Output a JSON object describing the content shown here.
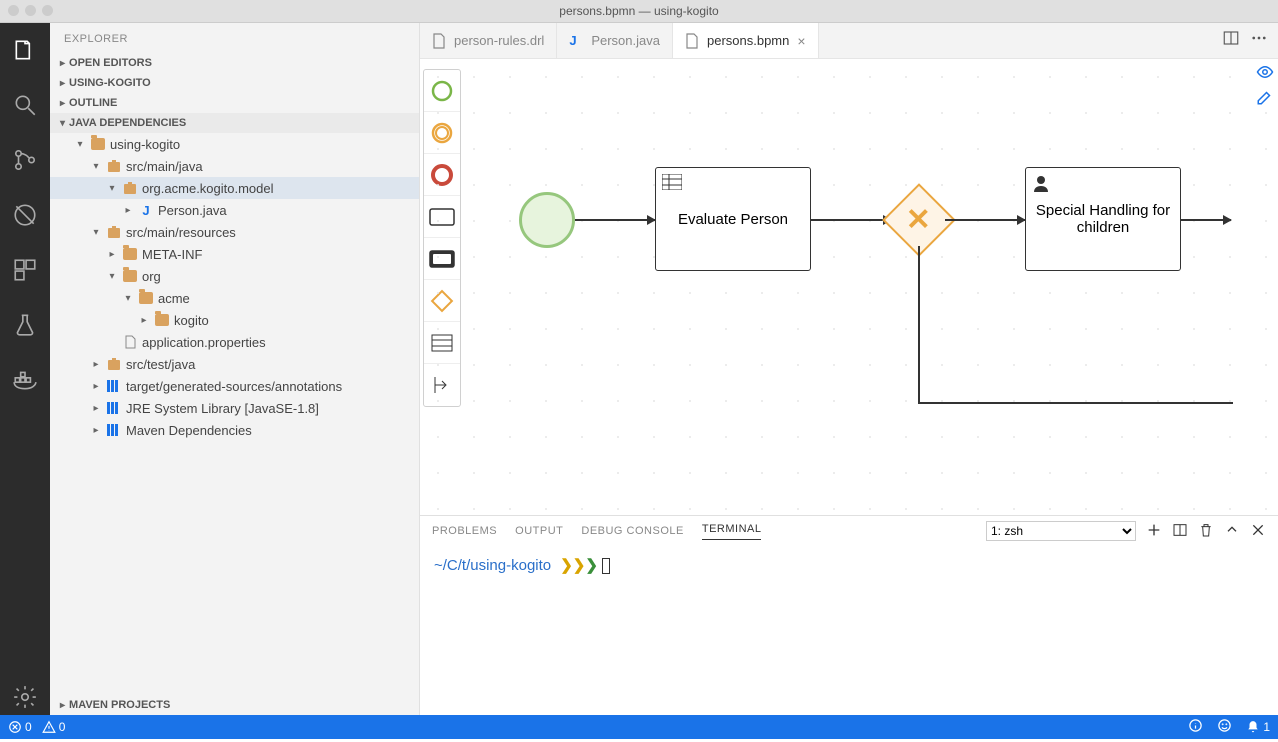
{
  "window": {
    "title": "persons.bpmn — using-kogito"
  },
  "sidebar": {
    "title": "EXPLORER",
    "sections": [
      {
        "label": "OPEN EDITORS",
        "expanded": false
      },
      {
        "label": "USING-KOGITO",
        "expanded": false
      },
      {
        "label": "OUTLINE",
        "expanded": false
      },
      {
        "label": "JAVA DEPENDENCIES",
        "expanded": true
      },
      {
        "label": "MAVEN PROJECTS",
        "expanded": false
      }
    ],
    "tree": [
      {
        "indent": 1,
        "chev": "▾",
        "icon": "folder",
        "label": "using-kogito"
      },
      {
        "indent": 2,
        "chev": "▾",
        "icon": "pkg",
        "label": "src/main/java"
      },
      {
        "indent": 3,
        "chev": "▾",
        "icon": "pkg",
        "label": "org.acme.kogito.model",
        "selected": true
      },
      {
        "indent": 4,
        "chev": "▸",
        "icon": "java",
        "label": "Person.java"
      },
      {
        "indent": 2,
        "chev": "▾",
        "icon": "pkg",
        "label": "src/main/resources"
      },
      {
        "indent": 3,
        "chev": "▸",
        "icon": "folder",
        "label": "META-INF"
      },
      {
        "indent": 3,
        "chev": "▾",
        "icon": "folder",
        "label": "org"
      },
      {
        "indent": 4,
        "chev": "▾",
        "icon": "folder",
        "label": "acme"
      },
      {
        "indent": 5,
        "chev": "▸",
        "icon": "folder",
        "label": "kogito"
      },
      {
        "indent": 3,
        "chev": "",
        "icon": "file",
        "label": "application.properties"
      },
      {
        "indent": 2,
        "chev": "▸",
        "icon": "pkg",
        "label": "src/test/java"
      },
      {
        "indent": 2,
        "chev": "▸",
        "icon": "lib",
        "label": "target/generated-sources/annotations"
      },
      {
        "indent": 2,
        "chev": "▸",
        "icon": "lib",
        "label": "JRE System Library [JavaSE-1.8]"
      },
      {
        "indent": 2,
        "chev": "▸",
        "icon": "lib",
        "label": "Maven Dependencies"
      }
    ]
  },
  "tabs": [
    {
      "label": "person-rules.drl",
      "icon": "file",
      "active": false
    },
    {
      "label": "Person.java",
      "icon": "java",
      "active": false
    },
    {
      "label": "persons.bpmn",
      "icon": "file",
      "active": true,
      "close": true
    }
  ],
  "bpmn": {
    "task1": "Evaluate Person",
    "task2": "Special Handling for children"
  },
  "panel": {
    "tabs": [
      "PROBLEMS",
      "OUTPUT",
      "DEBUG CONSOLE",
      "TERMINAL"
    ],
    "activeTab": "TERMINAL",
    "terminalSelect": "1: zsh",
    "promptPath": "~/C/t/using-kogito",
    "promptArrows": "❯❯❯"
  },
  "statusbar": {
    "errors": "0",
    "warnings": "0",
    "notifications": "1"
  }
}
